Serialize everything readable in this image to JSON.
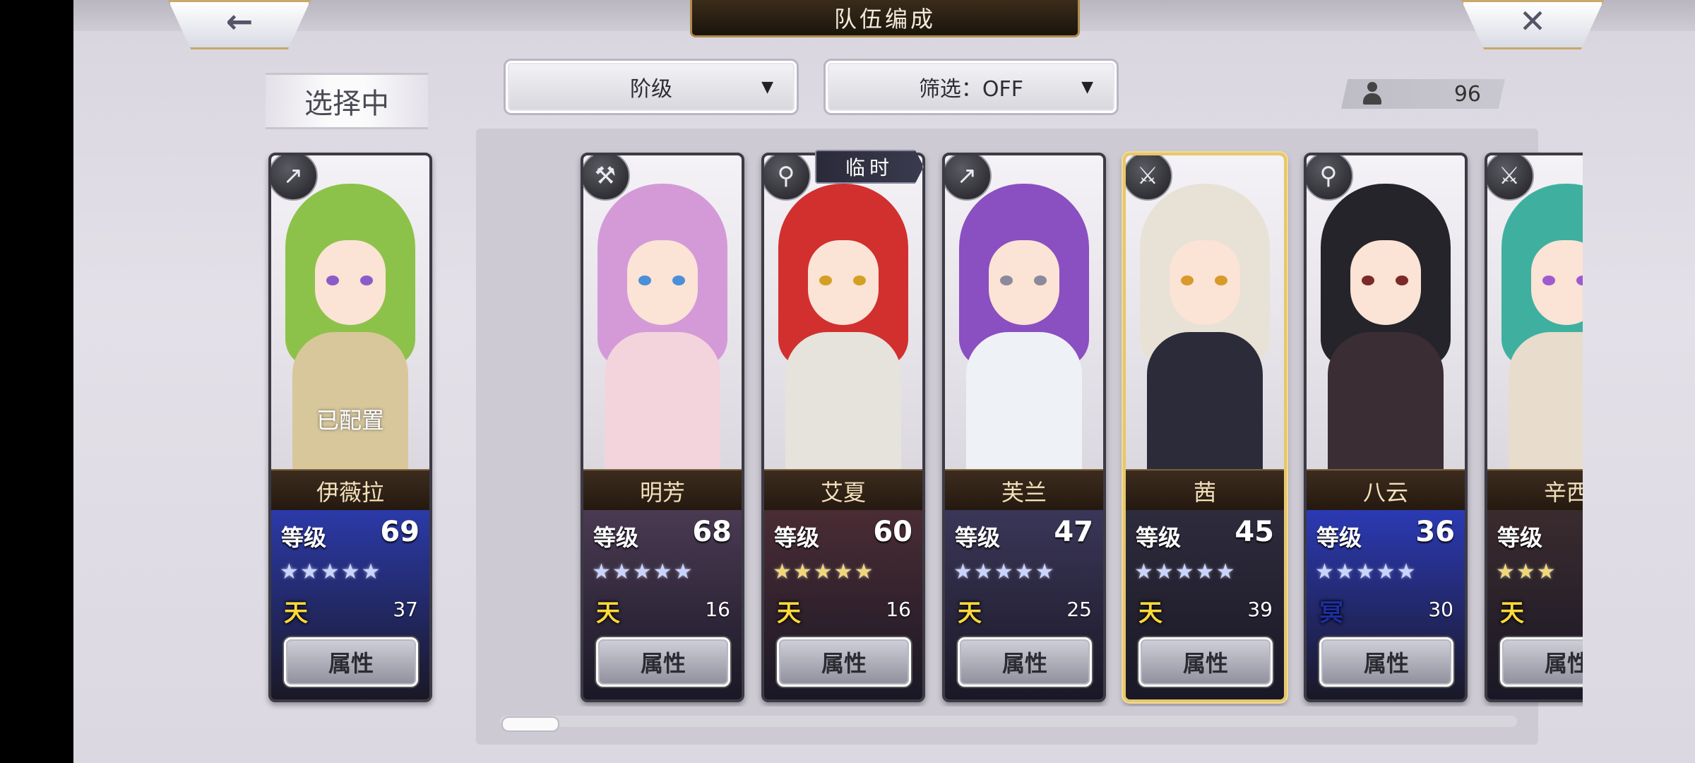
{
  "header": {
    "title": "队伍编成",
    "back_icon": "←",
    "close_icon": "✕"
  },
  "selecting": {
    "label": "选择中"
  },
  "filters": {
    "sort_label": "阶级",
    "filter_label": "筛选：OFF",
    "arrow": "▼"
  },
  "roster_count": "96",
  "temp_tag": "临时",
  "current_character": {
    "name": "伊薇拉",
    "level_label": "等级",
    "level": "69",
    "stars": "★★★★★",
    "star_color": "#c9d4ff",
    "tier_glyph": "天",
    "tier_color": "#ffd93a",
    "tier_value": "37",
    "assigned_text": "已配置",
    "attr_label": "属性",
    "weapon": "↗",
    "hair": "#8dc24a",
    "outfit": "#d8c79a",
    "stats_bg": "#2b3aa8",
    "eye": "#8b5cc9"
  },
  "characters": [
    {
      "name": "明芳",
      "level_label": "等级",
      "level": "68",
      "stars": "★★★★★",
      "star_color": "#c9d4ff",
      "tier_glyph": "天",
      "tier_color": "#ffd93a",
      "tier_value": "16",
      "attr_label": "属性",
      "weapon": "⚒",
      "hair": "#d49ad8",
      "outfit": "#f3d4dc",
      "stats_bg": "#4a3a52",
      "eye": "#4a8fd8"
    },
    {
      "name": "艾夏",
      "level_label": "等级",
      "level": "60",
      "stars": "★★★★★",
      "star_color": "#f0d77a",
      "tier_glyph": "天",
      "tier_color": "#ffd93a",
      "tier_value": "16",
      "attr_label": "属性",
      "weapon": "⚲",
      "hair": "#d1302f",
      "outfit": "#e6e3dc",
      "stats_bg": "#4a2c34",
      "eye": "#d4a023"
    },
    {
      "name": "芙兰",
      "level_label": "等级",
      "level": "47",
      "stars": "★★★★★",
      "star_color": "#c9d4ff",
      "tier_glyph": "天",
      "tier_color": "#ffd93a",
      "tier_value": "25",
      "attr_label": "属性",
      "weapon": "↗",
      "hair": "#8a4fc0",
      "outfit": "#eef2f6",
      "stats_bg": "#3a3658",
      "eye": "#8a8a9a"
    },
    {
      "name": "茜",
      "level_label": "等级",
      "level": "45",
      "stars": "★★★★★",
      "star_color": "#c9d4ff",
      "tier_glyph": "天",
      "tier_color": "#ffd93a",
      "tier_value": "39",
      "attr_label": "属性",
      "weapon": "⚔",
      "hair": "#e8e2d6",
      "outfit": "#2b2b3a",
      "stats_bg": "#2e2c3c",
      "eye": "#d89a2a"
    },
    {
      "name": "八云",
      "level_label": "等级",
      "level": "36",
      "stars": "★★★★★",
      "star_color": "#c9d4ff",
      "tier_glyph": "冥",
      "tier_color": "#1d2fa0",
      "tier_value": "30",
      "attr_label": "属性",
      "weapon": "⚲",
      "hair": "#24242a",
      "outfit": "#3a2d34",
      "stats_bg": "#2b3ab4",
      "eye": "#7a2a2a"
    },
    {
      "name": "辛西",
      "level_label": "等级",
      "level": "",
      "stars": "★★★",
      "star_color": "#f0d77a",
      "tier_glyph": "天",
      "tier_color": "#ffd93a",
      "tier_value": "",
      "attr_label": "属性",
      "weapon": "⚔",
      "hair": "#3fb0a0",
      "outfit": "#e8dccc",
      "stats_bg": "#3a2b2e",
      "eye": "#a05ad0"
    }
  ]
}
